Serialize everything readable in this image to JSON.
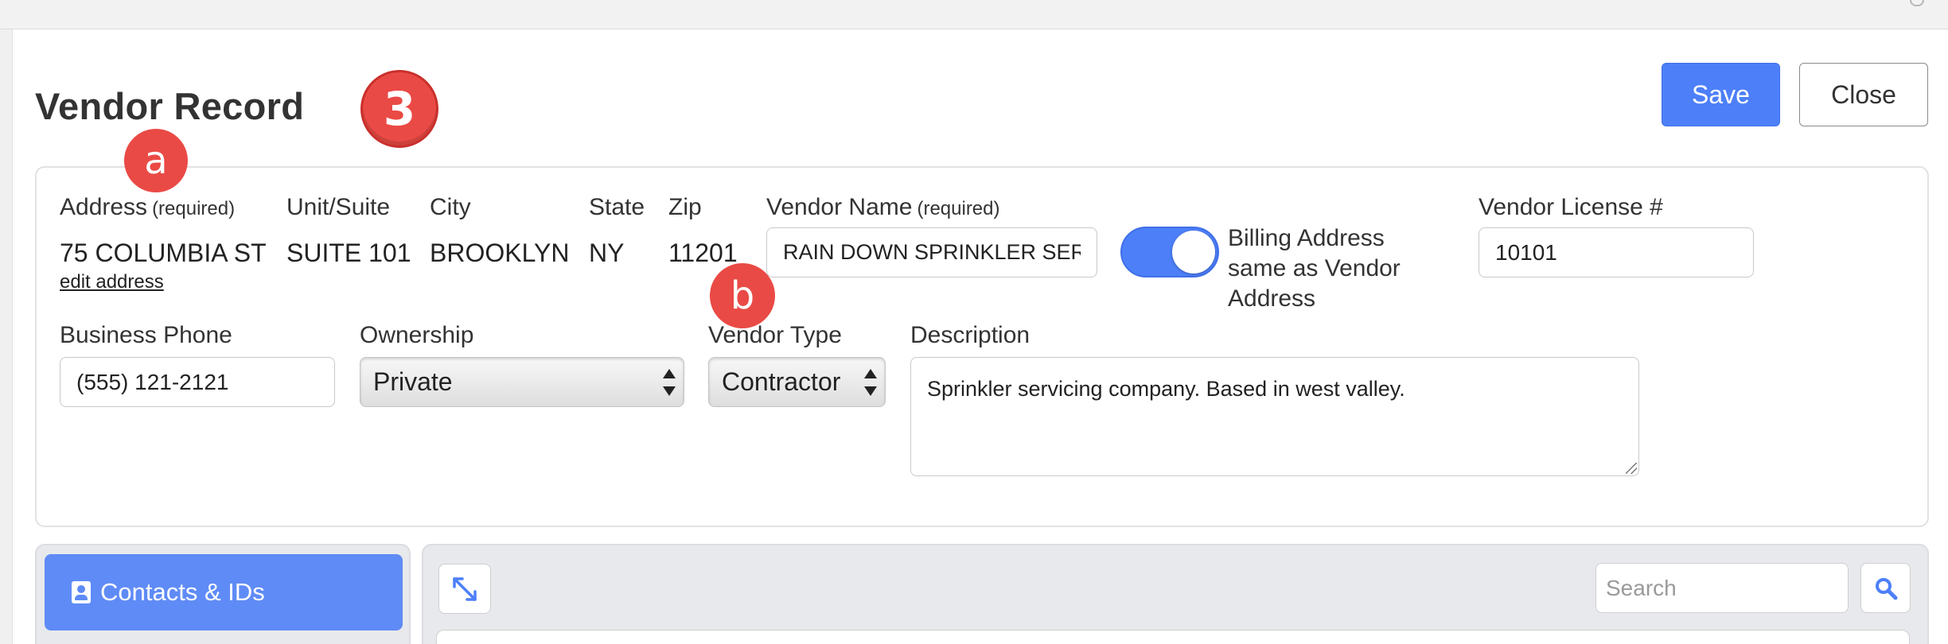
{
  "page": {
    "title": "Vendor Record",
    "step_badge": "3",
    "marker_a": "a",
    "marker_b": "b"
  },
  "toolbar": {
    "save_label": "Save",
    "close_label": "Close"
  },
  "address": {
    "label": "Address",
    "required_note": "(required)",
    "value": "75 COLUMBIA ST",
    "edit_link": "edit address",
    "unit_label": "Unit/Suite",
    "unit_value": "SUITE 101",
    "city_label": "City",
    "city_value": "BROOKLYN",
    "state_label": "State",
    "state_value": "NY",
    "zip_label": "Zip",
    "zip_value": "11201"
  },
  "vendor_name": {
    "label": "Vendor Name",
    "required_note": "(required)",
    "value": "RAIN DOWN SPRINKLER SER"
  },
  "billing_toggle": {
    "label": "Billing Address same as Vendor Address",
    "checked": true
  },
  "license": {
    "label": "Vendor License #",
    "value": "10101"
  },
  "phone": {
    "label": "Business Phone",
    "value": "(555) 121-2121"
  },
  "ownership": {
    "label": "Ownership",
    "selected": "Private"
  },
  "vendor_type": {
    "label": "Vendor Type",
    "selected": "Contractor"
  },
  "description": {
    "label": "Description",
    "value": "Sprinkler servicing company. Based in west valley."
  },
  "tabs": {
    "contacts_label": "Contacts & IDs"
  },
  "search": {
    "placeholder": "Search"
  },
  "colors": {
    "accent": "#4d7ff8",
    "badge": "#ea4a45"
  },
  "icons": {
    "expand": "expand-arrows-icon",
    "search": "magnifier-icon",
    "contact": "contact-card-icon"
  }
}
